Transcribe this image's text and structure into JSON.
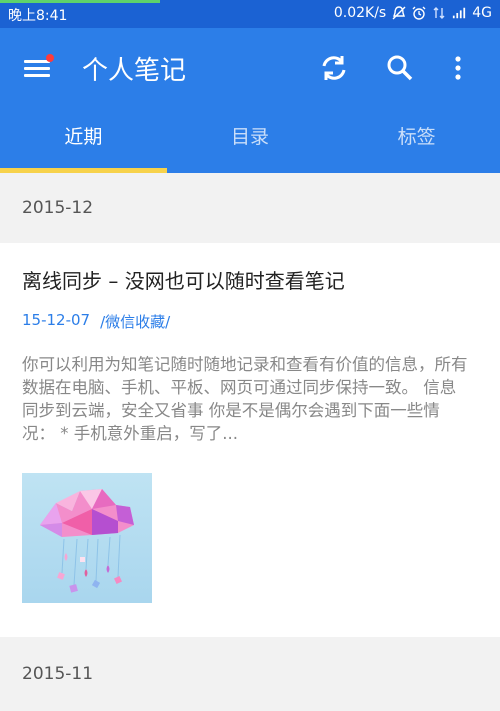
{
  "status_bar": {
    "time": "晚上8:41",
    "speed": "0.02K/s",
    "network": "4G"
  },
  "toolbar": {
    "title": "个人笔记"
  },
  "tabs": [
    {
      "label": "近期",
      "active": true
    },
    {
      "label": "目录",
      "active": false
    },
    {
      "label": "标签",
      "active": false
    }
  ],
  "sections": [
    {
      "header": "2015-12",
      "notes": [
        {
          "title": "离线同步 – 没网也可以随时查看笔记",
          "date": "15-12-07",
          "folder": "/微信收藏/",
          "excerpt": "你可以利用为知笔记随时随地记录和查看有价值的信息，所有数据在电脑、手机、平板、网页可通过同步保持一致。 信息同步到云端，安全又省事 你是不是偶尔会遇到下面一些情况： * 手机意外重启，写了..."
        }
      ]
    },
    {
      "header": "2015-11",
      "notes": []
    }
  ],
  "colors": {
    "status_bar": "#1b62d3",
    "toolbar": "#2c7ee8",
    "tab_indicator": "#f7d24b",
    "link": "#2c7ee8"
  },
  "icons": [
    "menu-icon",
    "sync-icon",
    "search-icon",
    "more-vert-icon"
  ]
}
